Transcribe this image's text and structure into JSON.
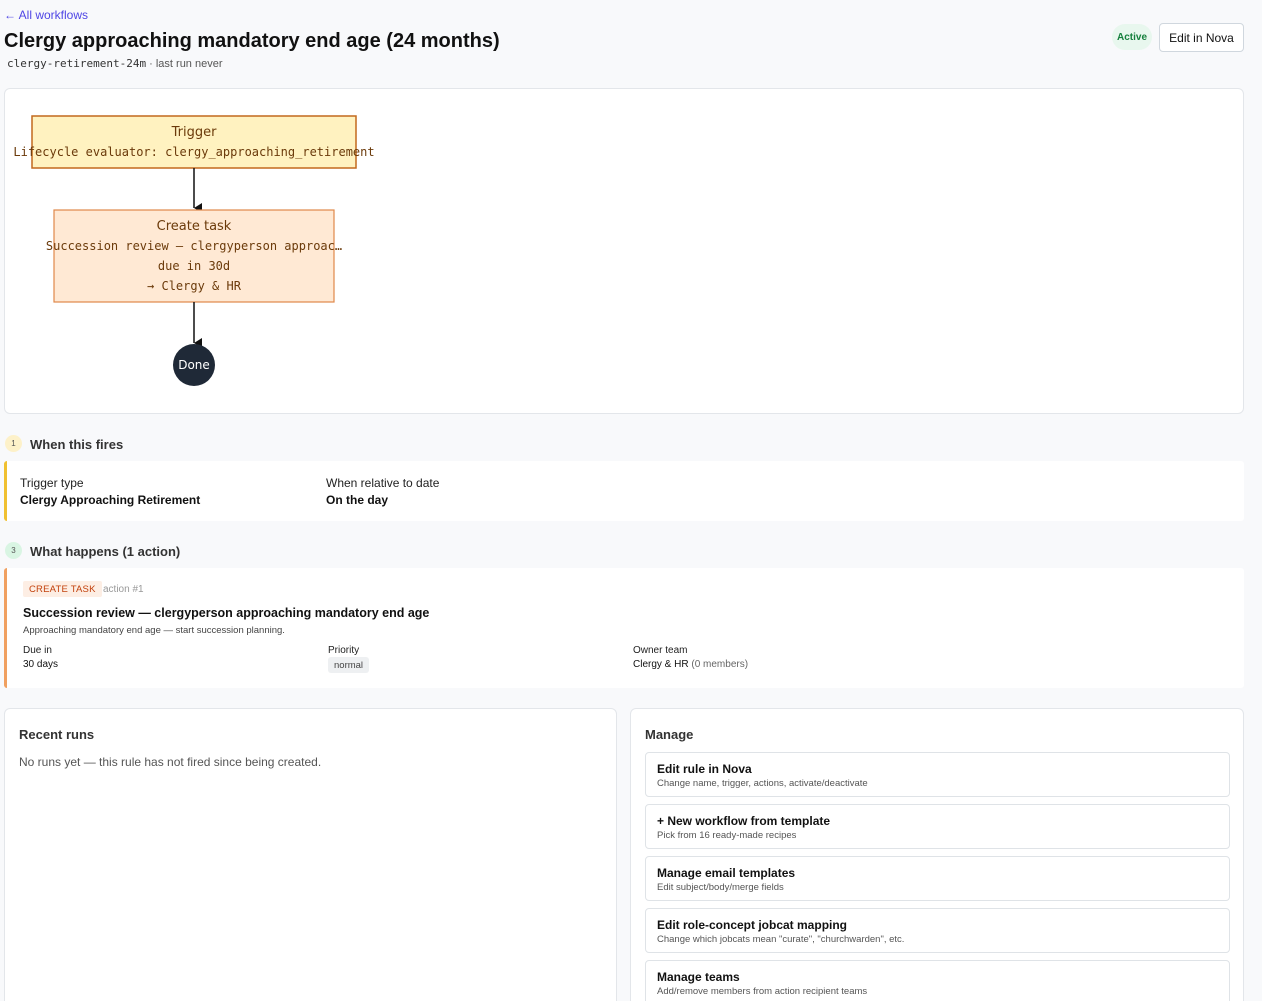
{
  "header": {
    "back_link": "← All workflows",
    "title": "Clergy approaching mandatory end age (24 months)",
    "slug": "clergy-retirement-24m",
    "last_run": " · last run never",
    "status": "Active",
    "edit_button": "Edit in Nova"
  },
  "flow": {
    "trigger_title": "Trigger",
    "trigger_detail": "Lifecycle evaluator: clergy_approaching_retirement",
    "task_title": "Create task",
    "task_line1": "Succession review — clergyperson approac…",
    "task_line2": "due in 30d",
    "task_line3": "→ Clergy & HR",
    "done_label": "Done"
  },
  "section_trigger": {
    "number": "1",
    "heading": "When this fires",
    "trigger_type_label": "Trigger type",
    "trigger_type_value": "Clergy Approaching Retirement",
    "relative_label": "When relative to date",
    "relative_value": "On the day"
  },
  "section_actions": {
    "number": "3",
    "heading": "What happens (1 action)",
    "action": {
      "tag": "CREATE TASK",
      "num": "action #1",
      "title": "Succession review — clergyperson approaching mandatory end age",
      "desc": "Approaching mandatory end age — start succession planning.",
      "due_label": "Due in",
      "due_value": "30 days",
      "priority_label": "Priority",
      "priority_value": "normal",
      "owner_label": "Owner team",
      "owner_value": "Clergy & HR",
      "owner_members": "(0 members)"
    }
  },
  "recent_runs": {
    "title": "Recent runs",
    "empty": "No runs yet — this rule has not fired since being created."
  },
  "manage": {
    "title": "Manage",
    "items": [
      {
        "title": "Edit rule in Nova",
        "desc": "Change name, trigger, actions, activate/deactivate"
      },
      {
        "title": "+ New workflow from template",
        "desc": "Pick from 16 ready-made recipes"
      },
      {
        "title": "Manage email templates",
        "desc": "Edit subject/body/merge fields"
      },
      {
        "title": "Edit role-concept jobcat mapping",
        "desc": "Change which jobcats mean \"curate\", \"churchwarden\", etc."
      },
      {
        "title": "Manage teams",
        "desc": "Add/remove members from action recipient teams"
      }
    ]
  },
  "colors": {
    "accent": "#4f46e5",
    "active_green": "#15803d",
    "trigger_fill": "#fff2c0",
    "trigger_border": "#c2691d",
    "task_fill": "#ffe9d4",
    "task_border": "#e0884a",
    "done_fill": "#1f2937"
  }
}
